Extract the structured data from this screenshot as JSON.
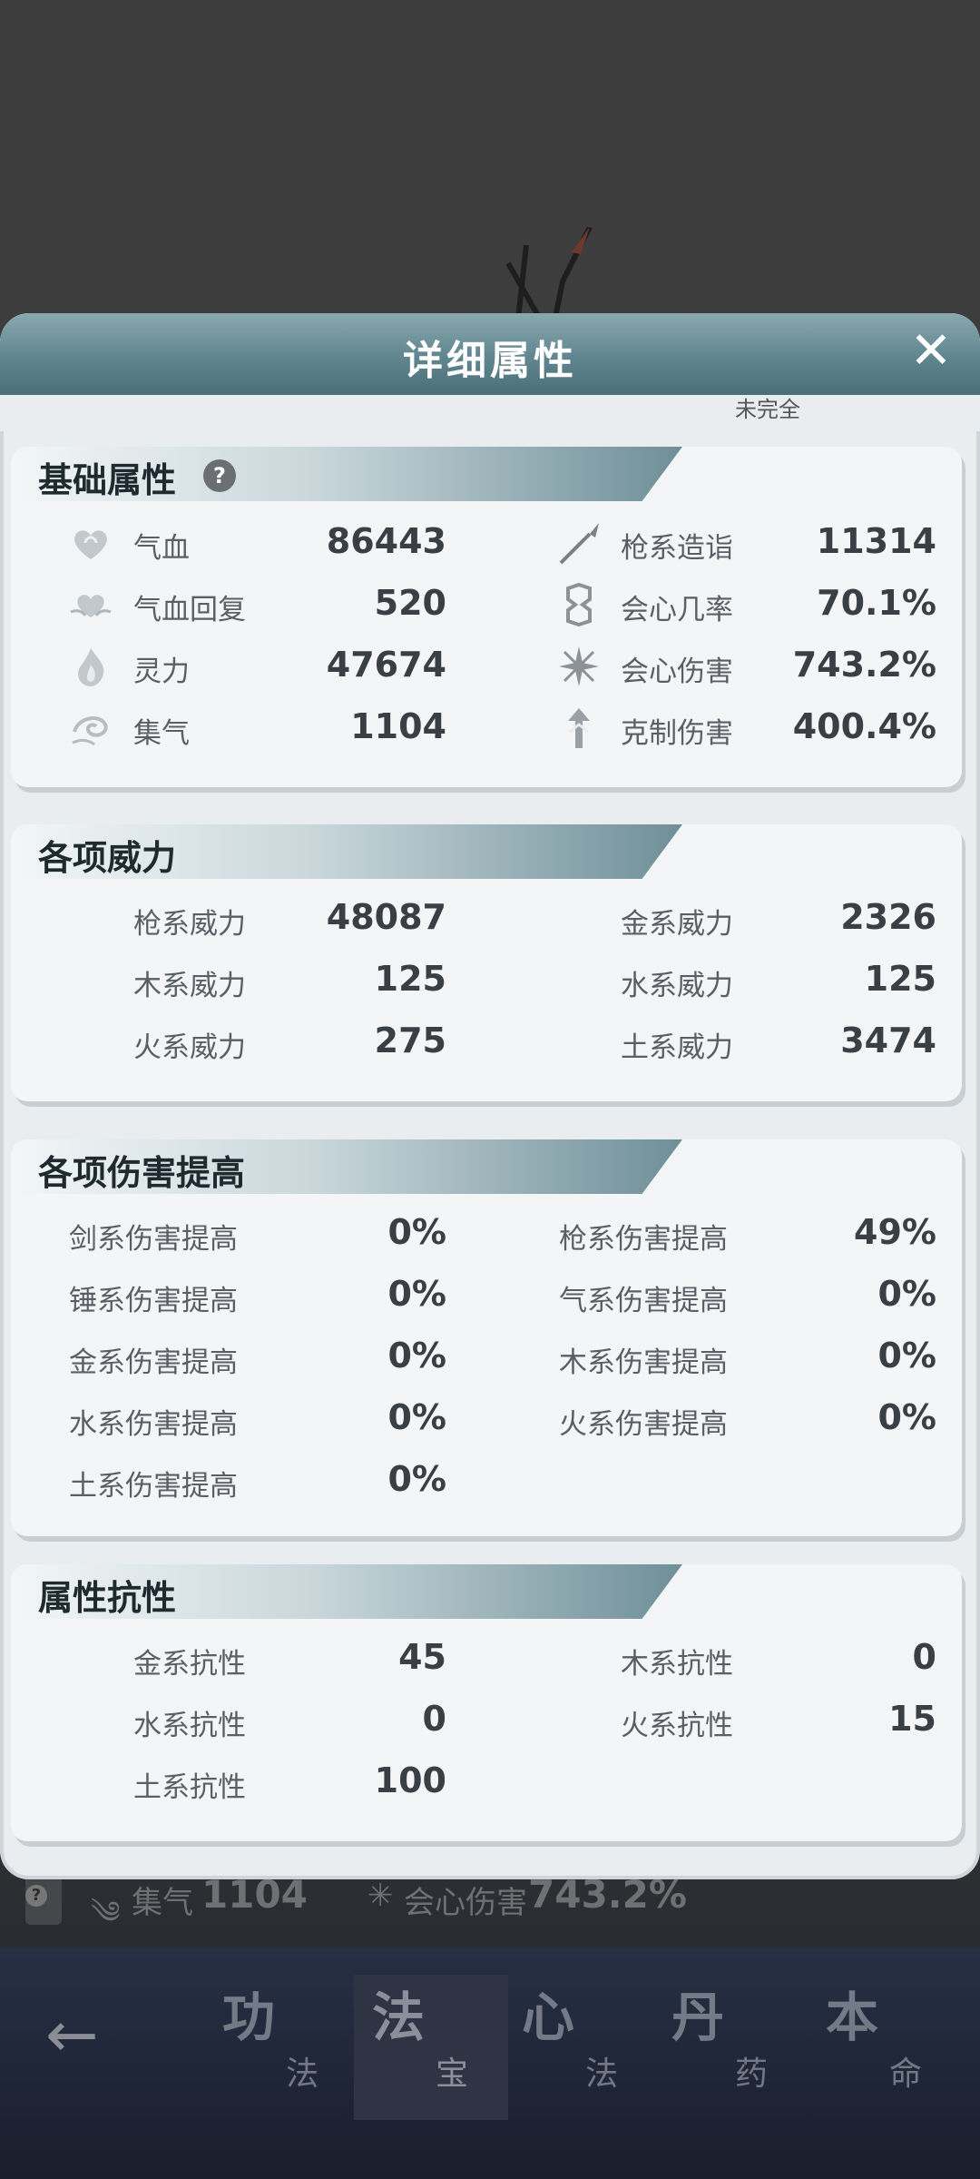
{
  "dialog": {
    "title": "详细属性",
    "close": "✕",
    "peek_text": "未完全"
  },
  "base": {
    "title": "基础属性",
    "help": "?",
    "left": [
      {
        "label": "气血",
        "value": "86443",
        "icon": "heart-icon"
      },
      {
        "label": "气血回复",
        "value": "520",
        "icon": "heart-regen-icon"
      },
      {
        "label": "灵力",
        "value": "47674",
        "icon": "flame-icon"
      },
      {
        "label": "集气",
        "value": "1104",
        "icon": "swirl-icon"
      }
    ],
    "right": [
      {
        "label": "枪系造诣",
        "value": "11314",
        "icon": "spear-icon"
      },
      {
        "label": "会心几率",
        "value": "70.1%",
        "icon": "crit-rate-icon"
      },
      {
        "label": "会心伤害",
        "value": "743.2%",
        "icon": "crit-damage-icon"
      },
      {
        "label": "克制伤害",
        "value": "400.4%",
        "icon": "counter-icon"
      }
    ]
  },
  "power": {
    "title": "各项威力",
    "left": [
      {
        "label": "枪系威力",
        "value": "48087"
      },
      {
        "label": "木系威力",
        "value": "125"
      },
      {
        "label": "火系威力",
        "value": "275"
      }
    ],
    "right": [
      {
        "label": "金系威力",
        "value": "2326"
      },
      {
        "label": "水系威力",
        "value": "125"
      },
      {
        "label": "土系威力",
        "value": "3474"
      }
    ]
  },
  "damage": {
    "title": "各项伤害提高",
    "left": [
      {
        "label": "剑系伤害提高",
        "value": "0%"
      },
      {
        "label": "锤系伤害提高",
        "value": "0%"
      },
      {
        "label": "金系伤害提高",
        "value": "0%"
      },
      {
        "label": "水系伤害提高",
        "value": "0%"
      },
      {
        "label": "土系伤害提高",
        "value": "0%"
      }
    ],
    "right": [
      {
        "label": "枪系伤害提高",
        "value": "49%"
      },
      {
        "label": "气系伤害提高",
        "value": "0%"
      },
      {
        "label": "木系伤害提高",
        "value": "0%"
      },
      {
        "label": "火系伤害提高",
        "value": "0%"
      }
    ]
  },
  "resist": {
    "title": "属性抗性",
    "left": [
      {
        "label": "金系抗性",
        "value": "45"
      },
      {
        "label": "水系抗性",
        "value": "0"
      },
      {
        "label": "土系抗性",
        "value": "100"
      }
    ],
    "right": [
      {
        "label": "木系抗性",
        "value": "0"
      },
      {
        "label": "火系抗性",
        "value": "15"
      }
    ]
  },
  "background_peek": {
    "qi_label": "集气",
    "qi_value": "1104",
    "crit_label": "会心伤害",
    "crit_value": "743.2%"
  },
  "nav": {
    "back": "←",
    "tabs": [
      {
        "big": "功",
        "small": "法"
      },
      {
        "big": "法",
        "small": "宝"
      },
      {
        "big": "心",
        "small": "法"
      },
      {
        "big": "丹",
        "small": "药"
      },
      {
        "big": "本",
        "small": "命"
      }
    ]
  }
}
